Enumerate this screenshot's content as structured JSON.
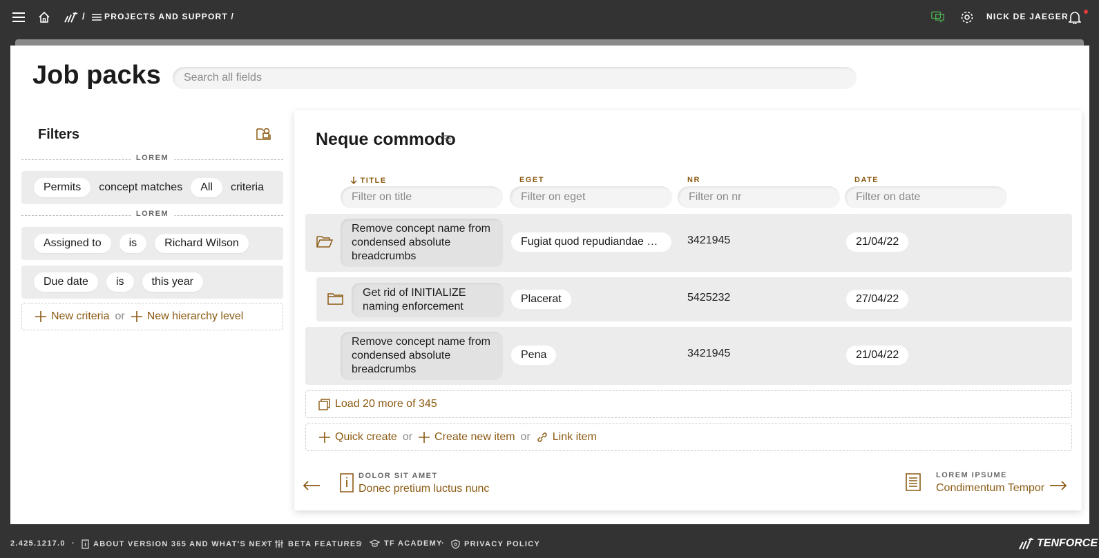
{
  "topbar": {
    "separator": "/",
    "breadcrumb": "PROJECTS AND SUPPORT /",
    "user": "NICK DE JAEGER"
  },
  "page": {
    "title": "Job packs",
    "search_placeholder": "Search all fields"
  },
  "filters": {
    "title": "Filters",
    "group1_label": "LOREM",
    "group2_label": "LOREM",
    "row1": [
      "Permits",
      "concept matches",
      "All",
      "criteria"
    ],
    "row2": [
      "Assigned to",
      "is",
      "Richard Wilson"
    ],
    "row3": [
      "Due date",
      "is",
      "this year"
    ],
    "new_criteria": "New criteria",
    "or": "or",
    "new_hierarchy": "New hierarchy level"
  },
  "panel": {
    "title": "Neque commodo",
    "columns": [
      {
        "label": "TITLE",
        "placeholder": "Filter on title"
      },
      {
        "label": "EGET",
        "placeholder": "Filter on eget"
      },
      {
        "label": "NR",
        "placeholder": "Filter on nr"
      },
      {
        "label": "DATE",
        "placeholder": "Filter on date"
      }
    ],
    "rows": [
      {
        "title": "Remove concept name from condensed absolute breadcrumbs",
        "eget": "Fugiat quod repudiandae ar…",
        "nr": "3421945",
        "date": "21/04/22"
      },
      {
        "title": "Get rid of INITIALIZE naming enforcement",
        "eget": "Placerat",
        "nr": "5425232",
        "date": "27/04/22"
      },
      {
        "title": "Remove concept name from condensed absolute breadcrumbs",
        "eget": "Pena",
        "nr": "3421945",
        "date": "21/04/22"
      }
    ],
    "load_more": "Load 20 more of 345",
    "quick_create": "Quick create",
    "or": "or",
    "create_new": "Create new item",
    "link_item": "Link item"
  },
  "nav": {
    "prev_label": "DOLOR SIT AMET",
    "prev_text": "Donec pretium luctus nunc",
    "next_label": "LOREM IPSUME",
    "next_text": "Condimentum Tempor"
  },
  "footer": {
    "version": "2.425.1217.0",
    "about": "ABOUT VERSION 365 AND WHAT'S NEXT",
    "beta": "BETA FEATURES",
    "academy": "TF ACADEMY",
    "privacy": "PRIVACY POLICY",
    "brand": "TENFORCE"
  },
  "colors": {
    "accent": "#8b5a12",
    "topbar_bg": "#333333",
    "row_bg": "#ececec",
    "chat_icon": "#4caf50",
    "notification_dot": "#e23a3a"
  }
}
